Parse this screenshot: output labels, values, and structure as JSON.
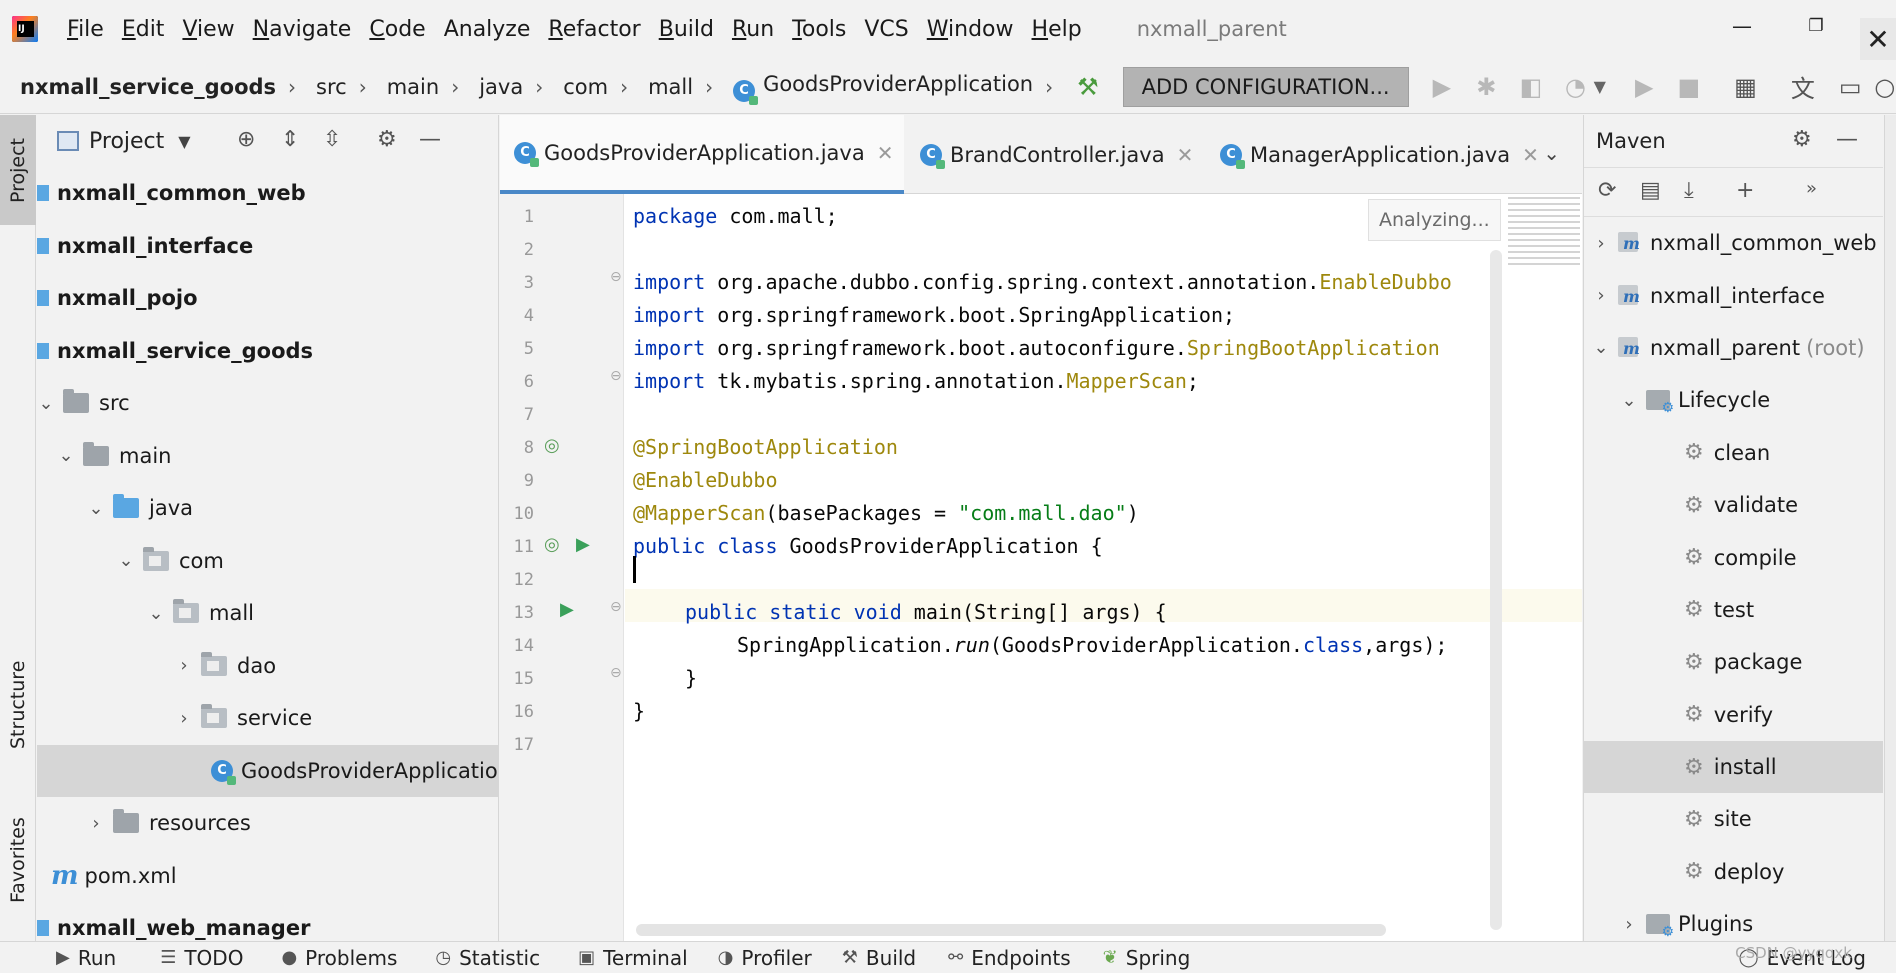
{
  "menu": {
    "items": [
      "File",
      "Edit",
      "View",
      "Navigate",
      "Code",
      "Analyze",
      "Refactor",
      "Build",
      "Run",
      "Tools",
      "VCS",
      "Window",
      "Help"
    ],
    "window_title": "nxmall_parent"
  },
  "window_controls": {
    "minimize": "—",
    "maximize": "❐",
    "close": "✕"
  },
  "breadcrumb": [
    "nxmall_service_goods",
    "src",
    "main",
    "java",
    "com",
    "mall",
    "GoodsProviderApplication"
  ],
  "toolbar": {
    "add_configuration": "ADD CONFIGURATION..."
  },
  "left_strip": {
    "project": "Project",
    "structure": "Structure",
    "favorites": "Favorites"
  },
  "project_panel": {
    "title": "Project",
    "tree": [
      {
        "label": "nxmall_common_web",
        "type": "module"
      },
      {
        "label": "nxmall_interface",
        "type": "module"
      },
      {
        "label": "nxmall_pojo",
        "type": "module"
      },
      {
        "label": "nxmall_service_goods",
        "type": "module"
      },
      {
        "label": "src",
        "type": "folder"
      },
      {
        "label": "main",
        "type": "folder"
      },
      {
        "label": "java",
        "type": "folder-blue"
      },
      {
        "label": "com",
        "type": "package"
      },
      {
        "label": "mall",
        "type": "package"
      },
      {
        "label": "dao",
        "type": "package"
      },
      {
        "label": "service",
        "type": "package"
      },
      {
        "label": "GoodsProviderApplicatio",
        "type": "class"
      },
      {
        "label": "resources",
        "type": "folder"
      },
      {
        "label": "pom.xml",
        "type": "pom"
      },
      {
        "label": "nxmall_web_manager",
        "type": "module"
      }
    ]
  },
  "editor": {
    "tabs": [
      {
        "label": "GoodsProviderApplication.java",
        "active": true
      },
      {
        "label": "BrandController.java",
        "active": false
      },
      {
        "label": "ManagerApplication.java",
        "active": false
      }
    ],
    "status": "Analyzing...",
    "line_numbers": [
      "1",
      "2",
      "3",
      "4",
      "5",
      "6",
      "7",
      "8",
      "9",
      "10",
      "11",
      "12",
      "13",
      "14",
      "15",
      "16",
      "17"
    ],
    "code": {
      "l1_kw": "package",
      "l1_rest": " com.mall;",
      "l3_kw": "import",
      "l3_rest": " org.apache.dubbo.config.spring.context.annotation.",
      "l3_an": "EnableDubbo",
      "l4_kw": "import",
      "l4_rest": " org.springframework.boot.SpringApplication;",
      "l5_kw": "import",
      "l5_rest": " org.springframework.boot.autoconfigure.",
      "l5_an": "SpringBootApplication",
      "l6_kw": "import",
      "l6_rest": " tk.mybatis.spring.annotation.",
      "l6_an": "MapperScan",
      "l6_end": ";",
      "l8": "@SpringBootApplication",
      "l9": "@EnableDubbo",
      "l10_an": "@MapperScan",
      "l10_a": "(basePackages = ",
      "l10_str": "\"com.mall.dao\"",
      "l10_b": ")",
      "l11_kw": "public class",
      "l11_rest": " GoodsProviderApplication {",
      "l13_kw": "public static void",
      "l13_rest": " main(String[] args) {",
      "l14_a": "SpringApplication.",
      "l14_it": "run",
      "l14_b": "(GoodsProviderApplication.",
      "l14_kw": "class",
      "l14_c": ",args);",
      "l15": "}",
      "l16": "}"
    }
  },
  "maven": {
    "title": "Maven",
    "tree": [
      {
        "label": "nxmall_common_web",
        "kind": "project"
      },
      {
        "label": "nxmall_interface",
        "kind": "project"
      },
      {
        "label": "nxmall_parent",
        "suffix": "(root)",
        "kind": "project-open"
      },
      {
        "label": "Lifecycle",
        "kind": "lifecycle"
      },
      {
        "label": "clean",
        "kind": "goal"
      },
      {
        "label": "validate",
        "kind": "goal"
      },
      {
        "label": "compile",
        "kind": "goal"
      },
      {
        "label": "test",
        "kind": "goal"
      },
      {
        "label": "package",
        "kind": "goal"
      },
      {
        "label": "verify",
        "kind": "goal"
      },
      {
        "label": "install",
        "kind": "goal",
        "selected": true
      },
      {
        "label": "site",
        "kind": "goal"
      },
      {
        "label": "deploy",
        "kind": "goal"
      },
      {
        "label": "Plugins",
        "kind": "plugins"
      }
    ]
  },
  "bottombar": {
    "items": [
      "Run",
      "TODO",
      "Problems",
      "Statistic",
      "Terminal",
      "Profiler",
      "Build",
      "Endpoints",
      "Spring"
    ],
    "event_log": "Event Log"
  },
  "watermark": "CSDN @yyqqxk",
  "colors": {
    "keyword": "#0033b3",
    "annotation": "#9e880d",
    "string": "#067d17",
    "tab_accent": "#4a88c7",
    "selection": "#d6d6d6"
  }
}
